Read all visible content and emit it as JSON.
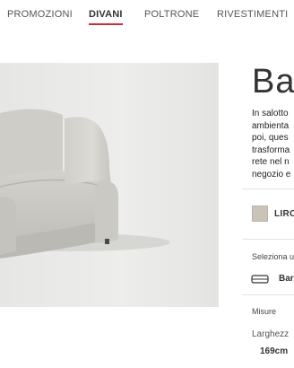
{
  "nav": {
    "items": [
      {
        "label": "PROMOZIONI"
      },
      {
        "label": "DIVANI"
      },
      {
        "label": "POLTRONE"
      },
      {
        "label": "RIVESTIMENTI"
      }
    ],
    "active_index": 1,
    "accent_color": "#c4313e"
  },
  "product": {
    "title": "Ba",
    "description": "In salotto\nambienta\npoi, ques\ntrasforma\nrete nel n\nnegozio e"
  },
  "fabric": {
    "label": "LIRC",
    "swatch_color": "#c9c3b9"
  },
  "configuration": {
    "prompt": "Seleziona u",
    "icon": "sofa-bed-icon",
    "selected": "Bar"
  },
  "dimensions": {
    "heading": "Misure",
    "width_label": "Larghezz",
    "width_value": "169cm"
  }
}
